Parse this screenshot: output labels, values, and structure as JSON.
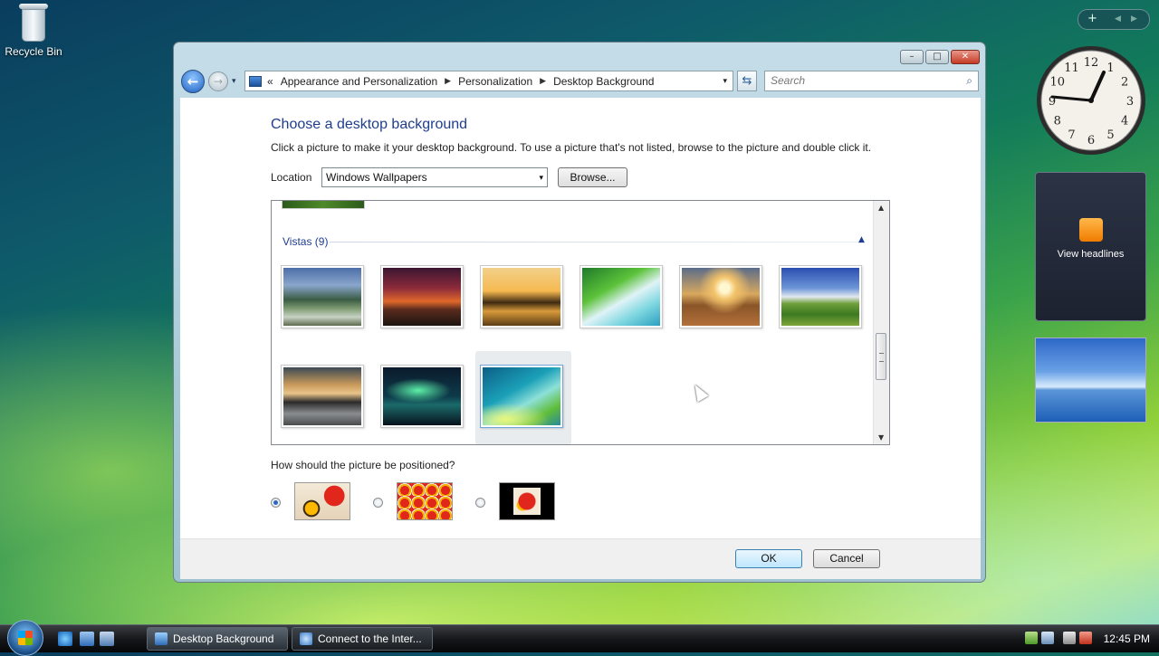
{
  "desktop": {
    "recycle_bin_label": "Recycle Bin"
  },
  "sidebar": {
    "controls": {
      "add": "+",
      "prev": "◀",
      "next": "▶"
    },
    "clock_numbers": [
      "12",
      "1",
      "2",
      "3",
      "4",
      "5",
      "6",
      "7",
      "8",
      "9",
      "10",
      "11"
    ],
    "feed_label": "View headlines"
  },
  "window": {
    "caption_buttons": {
      "minimize": "–",
      "maximize": "□",
      "close": "✕"
    },
    "nav": {
      "back": "←",
      "forward": "→",
      "recent": "▾"
    },
    "address": {
      "prefix": "«",
      "crumbs": [
        "Appearance and Personalization",
        "Personalization",
        "Desktop Background"
      ],
      "separator": "▶",
      "dropdown": "▾"
    },
    "refresh_icon": "⇆",
    "search": {
      "placeholder": "Search",
      "icon": "⌕"
    },
    "page_title": "Choose a desktop background",
    "instructions": "Click a picture to make it your desktop background. To use a picture that's not listed, browse to the picture and double click it.",
    "location": {
      "label": "Location",
      "value": "Windows Wallpapers",
      "arrow": "▾",
      "browse_label": "Browse..."
    },
    "gallery": {
      "group_title": "Vistas (9)",
      "group_chevron": "▲",
      "scroll_up": "▲",
      "scroll_down": "▼",
      "thumbnails": [
        {
          "name": "mountains-river",
          "selected": false
        },
        {
          "name": "red-sunset-hills",
          "selected": false
        },
        {
          "name": "golden-beach-rocks",
          "selected": false
        },
        {
          "name": "palm-leaf-lagoon",
          "selected": false
        },
        {
          "name": "sun-grass-field",
          "selected": false
        },
        {
          "name": "green-hills-sky",
          "selected": false
        },
        {
          "name": "rock-reflection-lake",
          "selected": false
        },
        {
          "name": "aurora-night",
          "selected": false
        },
        {
          "name": "vista-aurora-wave",
          "selected": true
        }
      ]
    },
    "position": {
      "question": "How should the picture be positioned?",
      "options": [
        "fit-to-screen",
        "tile",
        "center"
      ],
      "selected": "fit-to-screen"
    },
    "buttons": {
      "ok": "OK",
      "cancel": "Cancel"
    }
  },
  "taskbar": {
    "tasks": [
      {
        "label": "Desktop Background",
        "active": true
      },
      {
        "label": "Connect to the Inter...",
        "active": false
      }
    ],
    "clock": "12:45 PM"
  }
}
